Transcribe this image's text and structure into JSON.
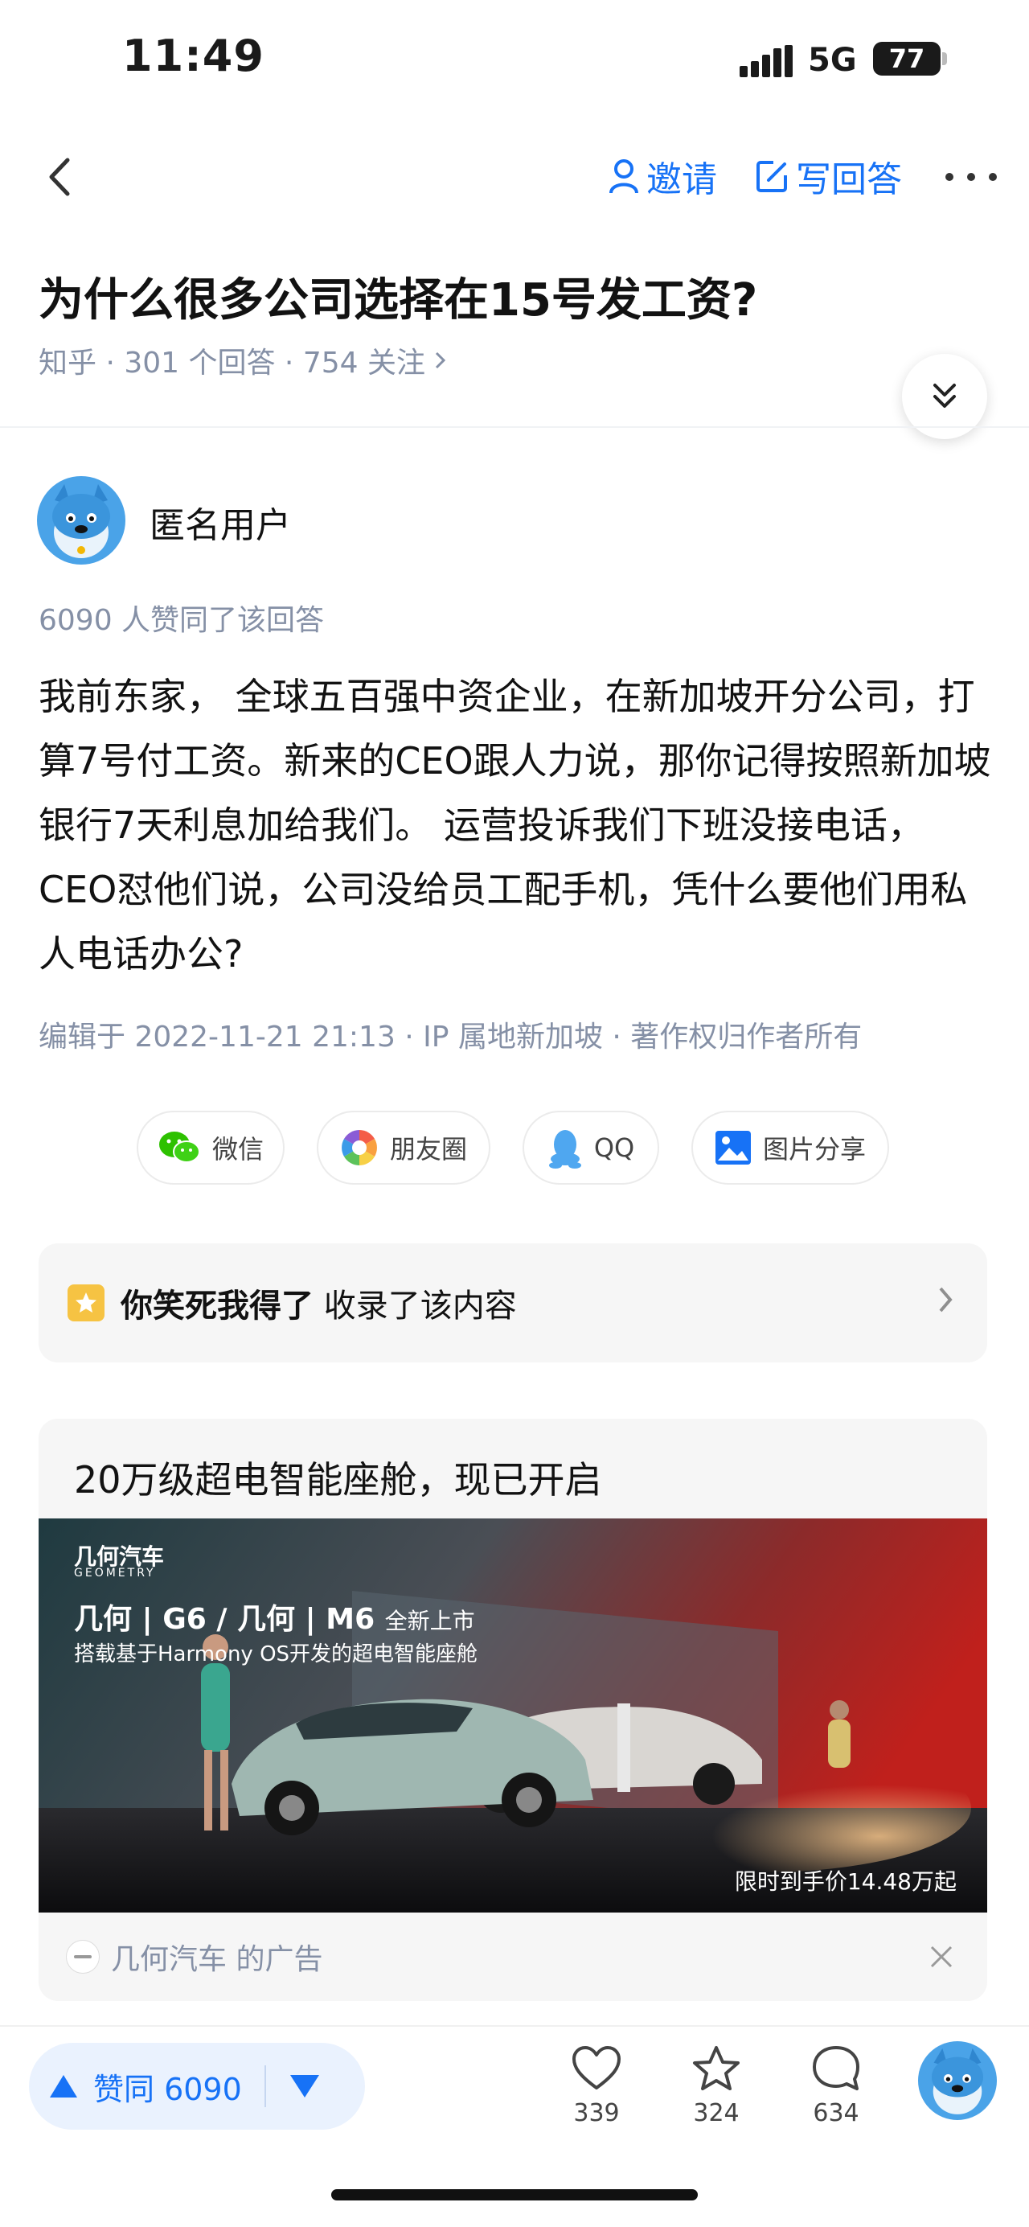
{
  "status_bar": {
    "time": "11:49",
    "network": "5G",
    "battery": "77"
  },
  "nav": {
    "invite_label": "邀请",
    "write_answer_label": "写回答"
  },
  "question": {
    "title": "为什么很多公司选择在15号发工资?",
    "meta": "知乎 · 301 个回答 · 754 关注"
  },
  "author": {
    "name": "匿名用户"
  },
  "answer": {
    "vote_summary": "6090 人赞同了该回答",
    "body": "我前东家， 全球五百强中资企业，在新加坡开分公司，打算7号付工资。新来的CEO跟人力说，那你记得按照新加坡银行7天利息加给我们。 运营投诉我们下班没接电话，CEO怼他们说，公司没给员工配手机，凭什么要他们用私人电话办公?",
    "edit_info": "编辑于 2022-11-21 21:13 · IP 属地新加坡 · 著作权归作者所有"
  },
  "share": {
    "wechat": "微信",
    "moments": "朋友圈",
    "qq": "QQ",
    "image": "图片分享"
  },
  "collection": {
    "name": "你笑死我得了",
    "action": "收录了该内容"
  },
  "ad": {
    "title": "20万级超电智能座舱，现已开启",
    "brand": "几何汽车",
    "brand_en": "GEOMETRY",
    "headline": "几何 | G6 / 几何 | M6",
    "headline_tag": "全新上市",
    "subline": "搭载基于Harmony OS开发的超电智能座舱",
    "price": "限时到手价14.48万起",
    "source": "几何汽车 的广告"
  },
  "bottom_bar": {
    "vote_label": "赞同 6090",
    "likes": "339",
    "favorites": "324",
    "comments": "634"
  },
  "colors": {
    "accent": "#1772f6",
    "muted": "#8590a6"
  }
}
